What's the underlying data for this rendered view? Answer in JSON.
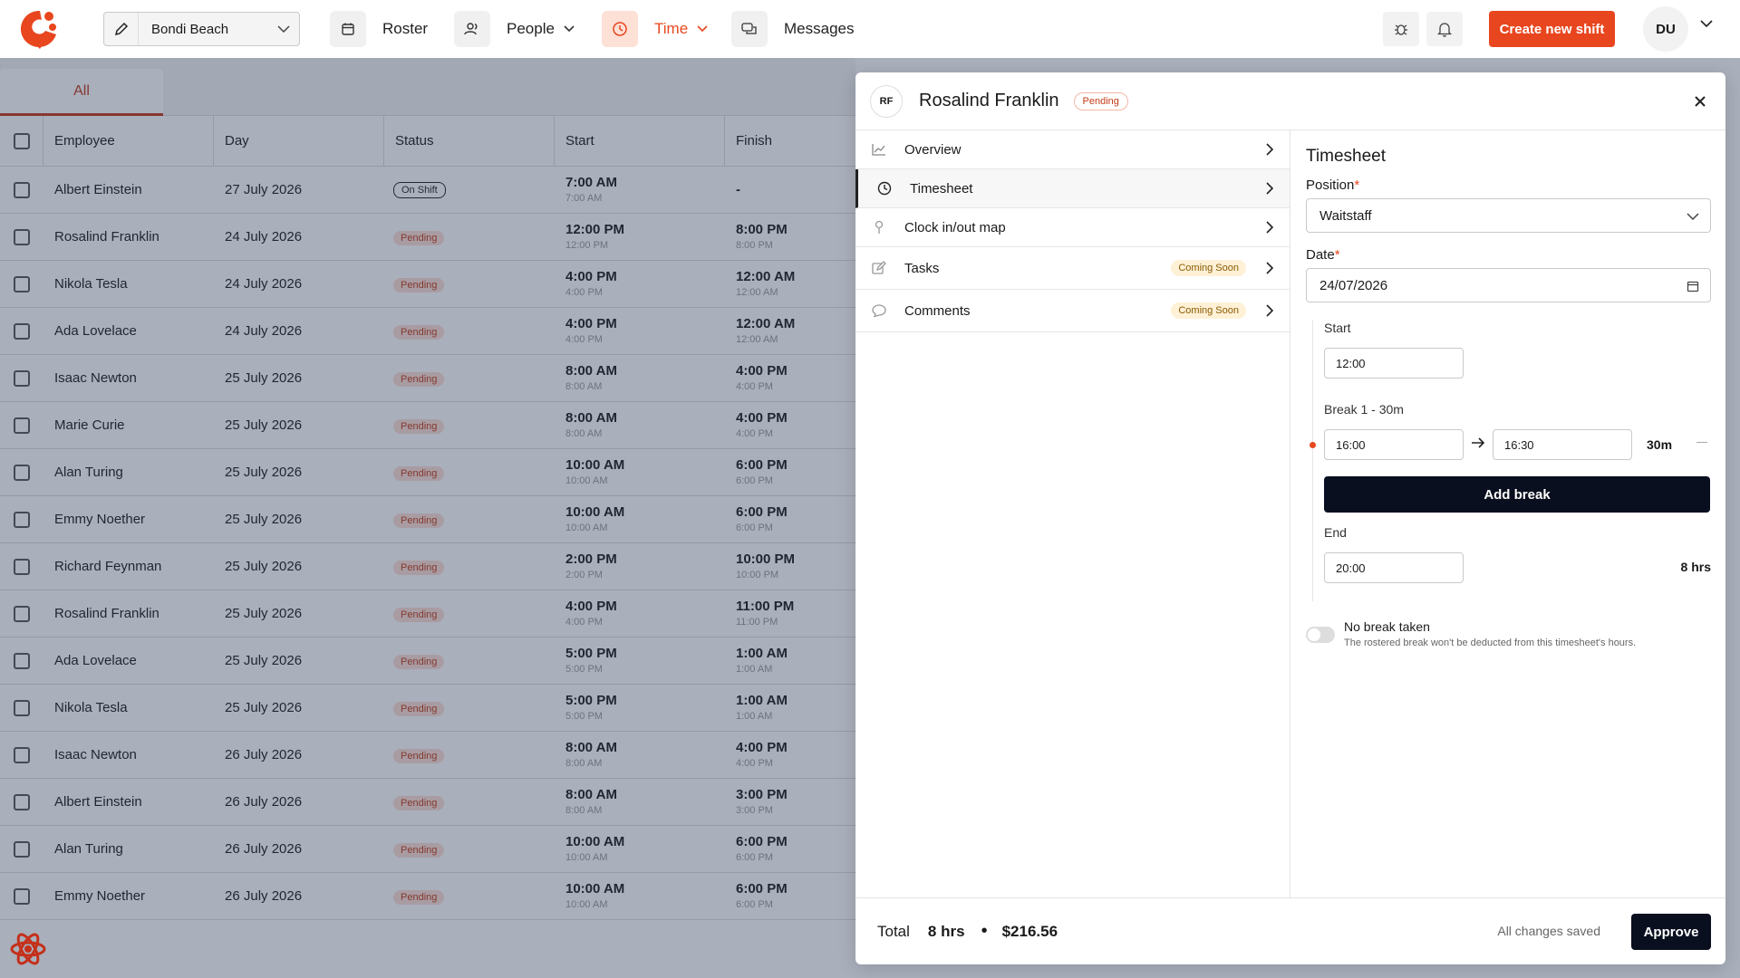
{
  "header": {
    "location": "Bondi Beach",
    "nav": [
      {
        "label": "Roster",
        "icon": "calendar-icon"
      },
      {
        "label": "People",
        "icon": "people-icon"
      },
      {
        "label": "Time",
        "icon": "clock-icon"
      },
      {
        "label": "Messages",
        "icon": "chat-icon"
      }
    ],
    "create_label": "Create new shift",
    "user_initials": "DU",
    "accent": "#e8461e"
  },
  "table": {
    "tab_all": "All",
    "columns": [
      "Employee",
      "Day",
      "Status",
      "Start",
      "Finish"
    ],
    "rows": [
      {
        "employee": "Albert Einstein",
        "day": "27 July 2026",
        "status": "On Shift",
        "start": "7:00 AM",
        "start_sub": "7:00 AM",
        "finish": "-",
        "finish_sub": ""
      },
      {
        "employee": "Rosalind Franklin",
        "day": "24 July 2026",
        "status": "Pending",
        "start": "12:00 PM",
        "start_sub": "12:00 PM",
        "finish": "8:00 PM",
        "finish_sub": "8:00 PM"
      },
      {
        "employee": "Nikola Tesla",
        "day": "24 July 2026",
        "status": "Pending",
        "start": "4:00 PM",
        "start_sub": "4:00 PM",
        "finish": "12:00 AM",
        "finish_sub": "12:00 AM"
      },
      {
        "employee": "Ada Lovelace",
        "day": "24 July 2026",
        "status": "Pending",
        "start": "4:00 PM",
        "start_sub": "4:00 PM",
        "finish": "12:00 AM",
        "finish_sub": "12:00 AM"
      },
      {
        "employee": "Isaac Newton",
        "day": "25 July 2026",
        "status": "Pending",
        "start": "8:00 AM",
        "start_sub": "8:00 AM",
        "finish": "4:00 PM",
        "finish_sub": "4:00 PM"
      },
      {
        "employee": "Marie Curie",
        "day": "25 July 2026",
        "status": "Pending",
        "start": "8:00 AM",
        "start_sub": "8:00 AM",
        "finish": "4:00 PM",
        "finish_sub": "4:00 PM"
      },
      {
        "employee": "Alan Turing",
        "day": "25 July 2026",
        "status": "Pending",
        "start": "10:00 AM",
        "start_sub": "10:00 AM",
        "finish": "6:00 PM",
        "finish_sub": "6:00 PM"
      },
      {
        "employee": "Emmy Noether",
        "day": "25 July 2026",
        "status": "Pending",
        "start": "10:00 AM",
        "start_sub": "10:00 AM",
        "finish": "6:00 PM",
        "finish_sub": "6:00 PM"
      },
      {
        "employee": "Richard Feynman",
        "day": "25 July 2026",
        "status": "Pending",
        "start": "2:00 PM",
        "start_sub": "2:00 PM",
        "finish": "10:00 PM",
        "finish_sub": "10:00 PM"
      },
      {
        "employee": "Rosalind Franklin",
        "day": "25 July 2026",
        "status": "Pending",
        "start": "4:00 PM",
        "start_sub": "4:00 PM",
        "finish": "11:00 PM",
        "finish_sub": "11:00 PM"
      },
      {
        "employee": "Ada Lovelace",
        "day": "25 July 2026",
        "status": "Pending",
        "start": "5:00 PM",
        "start_sub": "5:00 PM",
        "finish": "1:00 AM",
        "finish_sub": "1:00 AM"
      },
      {
        "employee": "Nikola Tesla",
        "day": "25 July 2026",
        "status": "Pending",
        "start": "5:00 PM",
        "start_sub": "5:00 PM",
        "finish": "1:00 AM",
        "finish_sub": "1:00 AM"
      },
      {
        "employee": "Isaac Newton",
        "day": "26 July 2026",
        "status": "Pending",
        "start": "8:00 AM",
        "start_sub": "8:00 AM",
        "finish": "4:00 PM",
        "finish_sub": "4:00 PM"
      },
      {
        "employee": "Albert Einstein",
        "day": "26 July 2026",
        "status": "Pending",
        "start": "8:00 AM",
        "start_sub": "8:00 AM",
        "finish": "3:00 PM",
        "finish_sub": "3:00 PM"
      },
      {
        "employee": "Alan Turing",
        "day": "26 July 2026",
        "status": "Pending",
        "start": "10:00 AM",
        "start_sub": "10:00 AM",
        "finish": "6:00 PM",
        "finish_sub": "6:00 PM"
      },
      {
        "employee": "Emmy Noether",
        "day": "26 July 2026",
        "status": "Pending",
        "start": "10:00 AM",
        "start_sub": "10:00 AM",
        "finish": "6:00 PM",
        "finish_sub": "6:00 PM"
      }
    ]
  },
  "drawer": {
    "initials": "RF",
    "name": "Rosalind Franklin",
    "status": "Pending",
    "menu": [
      {
        "label": "Overview",
        "icon": "chart-icon",
        "badge": ""
      },
      {
        "label": "Timesheet",
        "icon": "clock-icon",
        "badge": ""
      },
      {
        "label": "Clock in/out map",
        "icon": "map-pin-icon",
        "badge": ""
      },
      {
        "label": "Tasks",
        "icon": "edit-icon",
        "badge": "Coming Soon"
      },
      {
        "label": "Comments",
        "icon": "comment-icon",
        "badge": "Coming Soon"
      }
    ],
    "timesheet": {
      "title": "Timesheet",
      "position_label": "Position",
      "position_value": "Waitstaff",
      "date_label": "Date",
      "date_value": "24/07/2026",
      "start_label": "Start",
      "start_value": "12:00",
      "break_label": "Break 1 - 30m",
      "break_from": "16:00",
      "break_to": "16:30",
      "break_duration": "30m",
      "add_break_label": "Add break",
      "end_label": "End",
      "end_value": "20:00",
      "end_hours": "8 hrs",
      "no_break_title": "No break taken",
      "no_break_sub": "The rostered break won't be deducted from this timesheet's hours."
    },
    "footer": {
      "total_label": "Total",
      "total_hours": "8 hrs",
      "total_cost": "$216.56",
      "saved_label": "All changes saved",
      "approve_label": "Approve"
    }
  }
}
